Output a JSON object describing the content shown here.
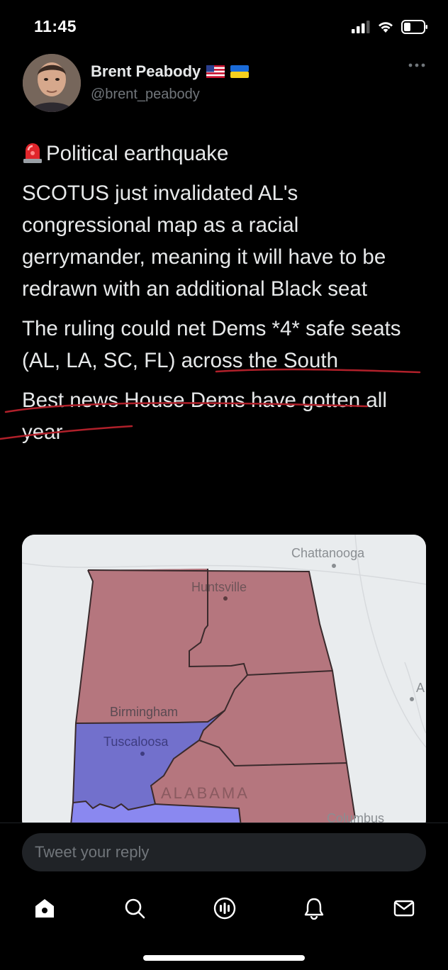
{
  "status_bar": {
    "time": "11:45"
  },
  "author": {
    "name": "Brent Peabody",
    "flags": [
      "us-flag-icon",
      "ukraine-flag-icon"
    ],
    "handle": "@brent_peabody"
  },
  "tweet": {
    "line1": "Political earthquake",
    "para1": "SCOTUS just invalidated AL's congressional map as a racial gerrymander, meaning it will have to be redrawn with an additional Black seat",
    "para2": "The ruling could net Dems *4* safe seats (AL, LA, SC, FL) across the South",
    "para3": "Best news House Dems have gotten all year"
  },
  "map": {
    "labels": {
      "chattanooga": "Chattanooga",
      "huntsville": "Huntsville",
      "birmingham": "Birmingham",
      "tuscaloosa": "Tuscaloosa",
      "alabama": "ALABAMA",
      "columbus": "Columbus",
      "edge": "A"
    },
    "colors": {
      "republican": "#b5767e",
      "democrat": "#7270cc",
      "land": "#e9ecee"
    }
  },
  "reply": {
    "placeholder": "Tweet your reply"
  },
  "nav": [
    "home-icon",
    "search-icon",
    "spaces-icon",
    "notifications-icon",
    "messages-icon"
  ],
  "annotation_color": "#b0202a"
}
